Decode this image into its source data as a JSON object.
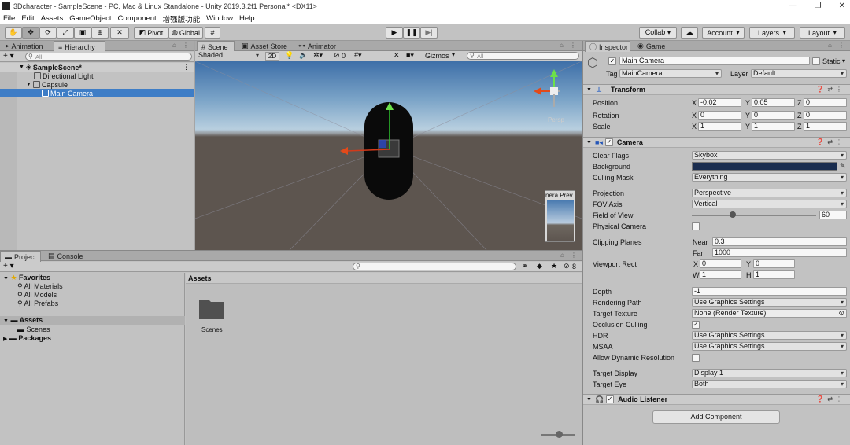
{
  "window": {
    "title": "3Dcharacter - SampleScene - PC, Mac & Linux Standalone - Unity 2019.3.2f1 Personal* <DX11>"
  },
  "menu": [
    "File",
    "Edit",
    "Assets",
    "GameObject",
    "Component",
    "增强版功能",
    "Window",
    "Help"
  ],
  "toolbar": {
    "pivot": "Pivot",
    "global": "Global",
    "collab": "Collab ▾",
    "account": "Account",
    "layers": "Layers",
    "layout": "Layout"
  },
  "left_tabs": {
    "animation": "Animation",
    "hierarchy": "Hierarchy"
  },
  "hierarchy": {
    "search_placeholder": "All",
    "items": [
      {
        "label": "SampleScene*",
        "indent": 0
      },
      {
        "label": "Directional Light",
        "indent": 2
      },
      {
        "label": "Capsule",
        "indent": 1
      },
      {
        "label": "Main Camera",
        "indent": 2
      }
    ]
  },
  "scene_tabs": {
    "scene": "Scene",
    "asset_store": "Asset Store",
    "animator": "Animator"
  },
  "scene_toolbar": {
    "shading": "Shaded",
    "mode2d": "2D",
    "hidden_count": "0",
    "gizmos": "Gizmos",
    "search_placeholder": "All"
  },
  "scene": {
    "persp_label": "Persp",
    "camera_preview": "nera Prev"
  },
  "project_tabs": {
    "project": "Project",
    "console": "Console"
  },
  "project": {
    "badge_count": "8",
    "favorites_label": "Favorites",
    "favorites": [
      "All Materials",
      "All Models",
      "All Prefabs"
    ],
    "assets_label": "Assets",
    "assets_children": [
      "Scenes"
    ],
    "packages_label": "Packages",
    "breadcrumb": "Assets",
    "folder_name": "Scenes"
  },
  "inspector_tabs": {
    "inspector": "Inspector",
    "game": "Game"
  },
  "inspector": {
    "object_name": "Main Camera",
    "static_label": "Static",
    "tag_label": "Tag",
    "tag_value": "MainCamera",
    "layer_label": "Layer",
    "layer_value": "Default",
    "transform": {
      "title": "Transform",
      "position_label": "Position",
      "position": {
        "x": "-0.02",
        "y": "0.05",
        "z": "0"
      },
      "rotation_label": "Rotation",
      "rotation": {
        "x": "0",
        "y": "0",
        "z": "0"
      },
      "scale_label": "Scale",
      "scale": {
        "x": "1",
        "y": "1",
        "z": "1"
      }
    },
    "camera": {
      "title": "Camera",
      "clear_flags_label": "Clear Flags",
      "clear_flags": "Skybox",
      "background_label": "Background",
      "background_color": "#1a2d4f",
      "culling_mask_label": "Culling Mask",
      "culling_mask": "Everything",
      "projection_label": "Projection",
      "projection": "Perspective",
      "fov_axis_label": "FOV Axis",
      "fov_axis": "Vertical",
      "fov_label": "Field of View",
      "fov": "60",
      "fov_fraction": 0.33,
      "physical_camera_label": "Physical Camera",
      "clipping_label": "Clipping Planes",
      "near_label": "Near",
      "near": "0.3",
      "far_label": "Far",
      "far": "1000",
      "viewport_label": "Viewport Rect",
      "vx": "0",
      "vy": "0",
      "vw": "1",
      "vh": "1",
      "depth_label": "Depth",
      "depth": "-1",
      "rendering_path_label": "Rendering Path",
      "rendering_path": "Use Graphics Settings",
      "target_texture_label": "Target Texture",
      "target_texture": "None (Render Texture)",
      "occlusion_label": "Occlusion Culling",
      "hdr_label": "HDR",
      "hdr": "Use Graphics Settings",
      "msaa_label": "MSAA",
      "msaa": "Use Graphics Settings",
      "dyn_res_label": "Allow Dynamic Resolution",
      "target_display_label": "Target Display",
      "target_display": "Display 1",
      "target_eye_label": "Target Eye",
      "target_eye": "Both"
    },
    "audio_listener_title": "Audio Listener",
    "add_component": "Add Component"
  },
  "colors": {
    "selection": "#3e7dc6",
    "panel": "#c2c2c2",
    "capsule": "#0a0a0a"
  }
}
